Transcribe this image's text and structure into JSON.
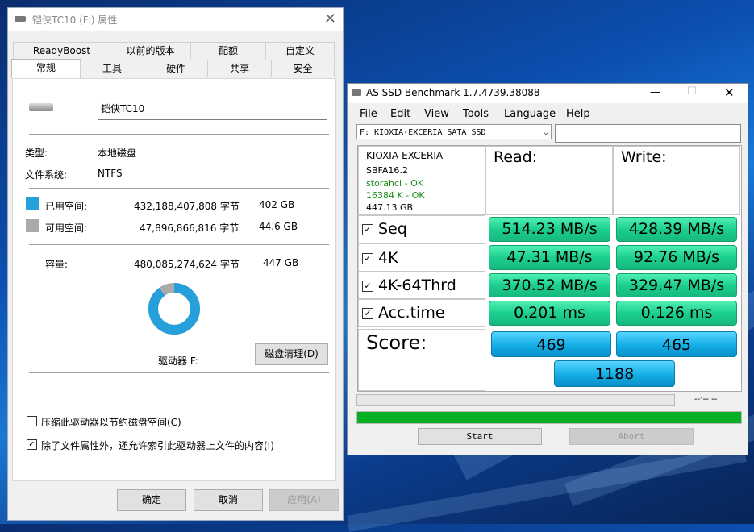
{
  "properties": {
    "title": "铠侠TC10 (F:) 属性",
    "tabs_top": [
      "ReadyBoost",
      "以前的版本",
      "配额",
      "自定义"
    ],
    "tabs_bottom": [
      "常规",
      "工具",
      "硬件",
      "共享",
      "安全"
    ],
    "name_value": "铠侠TC10",
    "type_label": "类型:",
    "type_value": "本地磁盘",
    "fs_label": "文件系统:",
    "fs_value": "NTFS",
    "used_label": "已用空间:",
    "used_bytes": "432,188,407,808 字节",
    "used_gb": "402 GB",
    "free_label": "可用空间:",
    "free_bytes": "47,896,866,816 字节",
    "free_gb": "44.6 GB",
    "cap_label": "容量:",
    "cap_bytes": "480,085,274,624 字节",
    "cap_gb": "447 GB",
    "used_fraction": 0.9,
    "drive_label": "驱动器 F:",
    "cleanup_button": "磁盘清理(D)",
    "compress_label": "压缩此驱动器以节约磁盘空间(C)",
    "index_label": "除了文件属性外，还允许索引此驱动器上文件的内容(I)",
    "ok": "确定",
    "cancel": "取消",
    "apply": "应用(A)",
    "colors": {
      "used": "#26a0da",
      "free": "#aaaaaa"
    }
  },
  "asssd": {
    "title": "AS SSD Benchmark 1.7.4739.38088",
    "menu": [
      "File",
      "Edit",
      "View",
      "Tools",
      "Language",
      "Help"
    ],
    "drive_select": "F: KIOXIA-EXCERIA SATA SSD",
    "info": {
      "model": "KIOXIA-EXCERIA",
      "firmware": "SBFA16.2",
      "driver": "storahci - OK",
      "align": "16384 K - OK",
      "size": "447.13 GB"
    },
    "read_header": "Read:",
    "write_header": "Write:",
    "rows": [
      {
        "label": "Seq",
        "read": "514.23 MB/s",
        "write": "428.39 MB/s"
      },
      {
        "label": "4K",
        "read": "47.31 MB/s",
        "write": "92.76 MB/s"
      },
      {
        "label": "4K-64Thrd",
        "read": "370.52 MB/s",
        "write": "329.47 MB/s"
      },
      {
        "label": "Acc.time",
        "read": "0.201 ms",
        "write": "0.126 ms"
      }
    ],
    "score_label": "Score:",
    "score_read": "469",
    "score_write": "465",
    "score_total": "1188",
    "timer": "--:--:--",
    "progress": 1.0,
    "start": "Start",
    "abort": "Abort",
    "ok_color": "#1a8a1a"
  }
}
